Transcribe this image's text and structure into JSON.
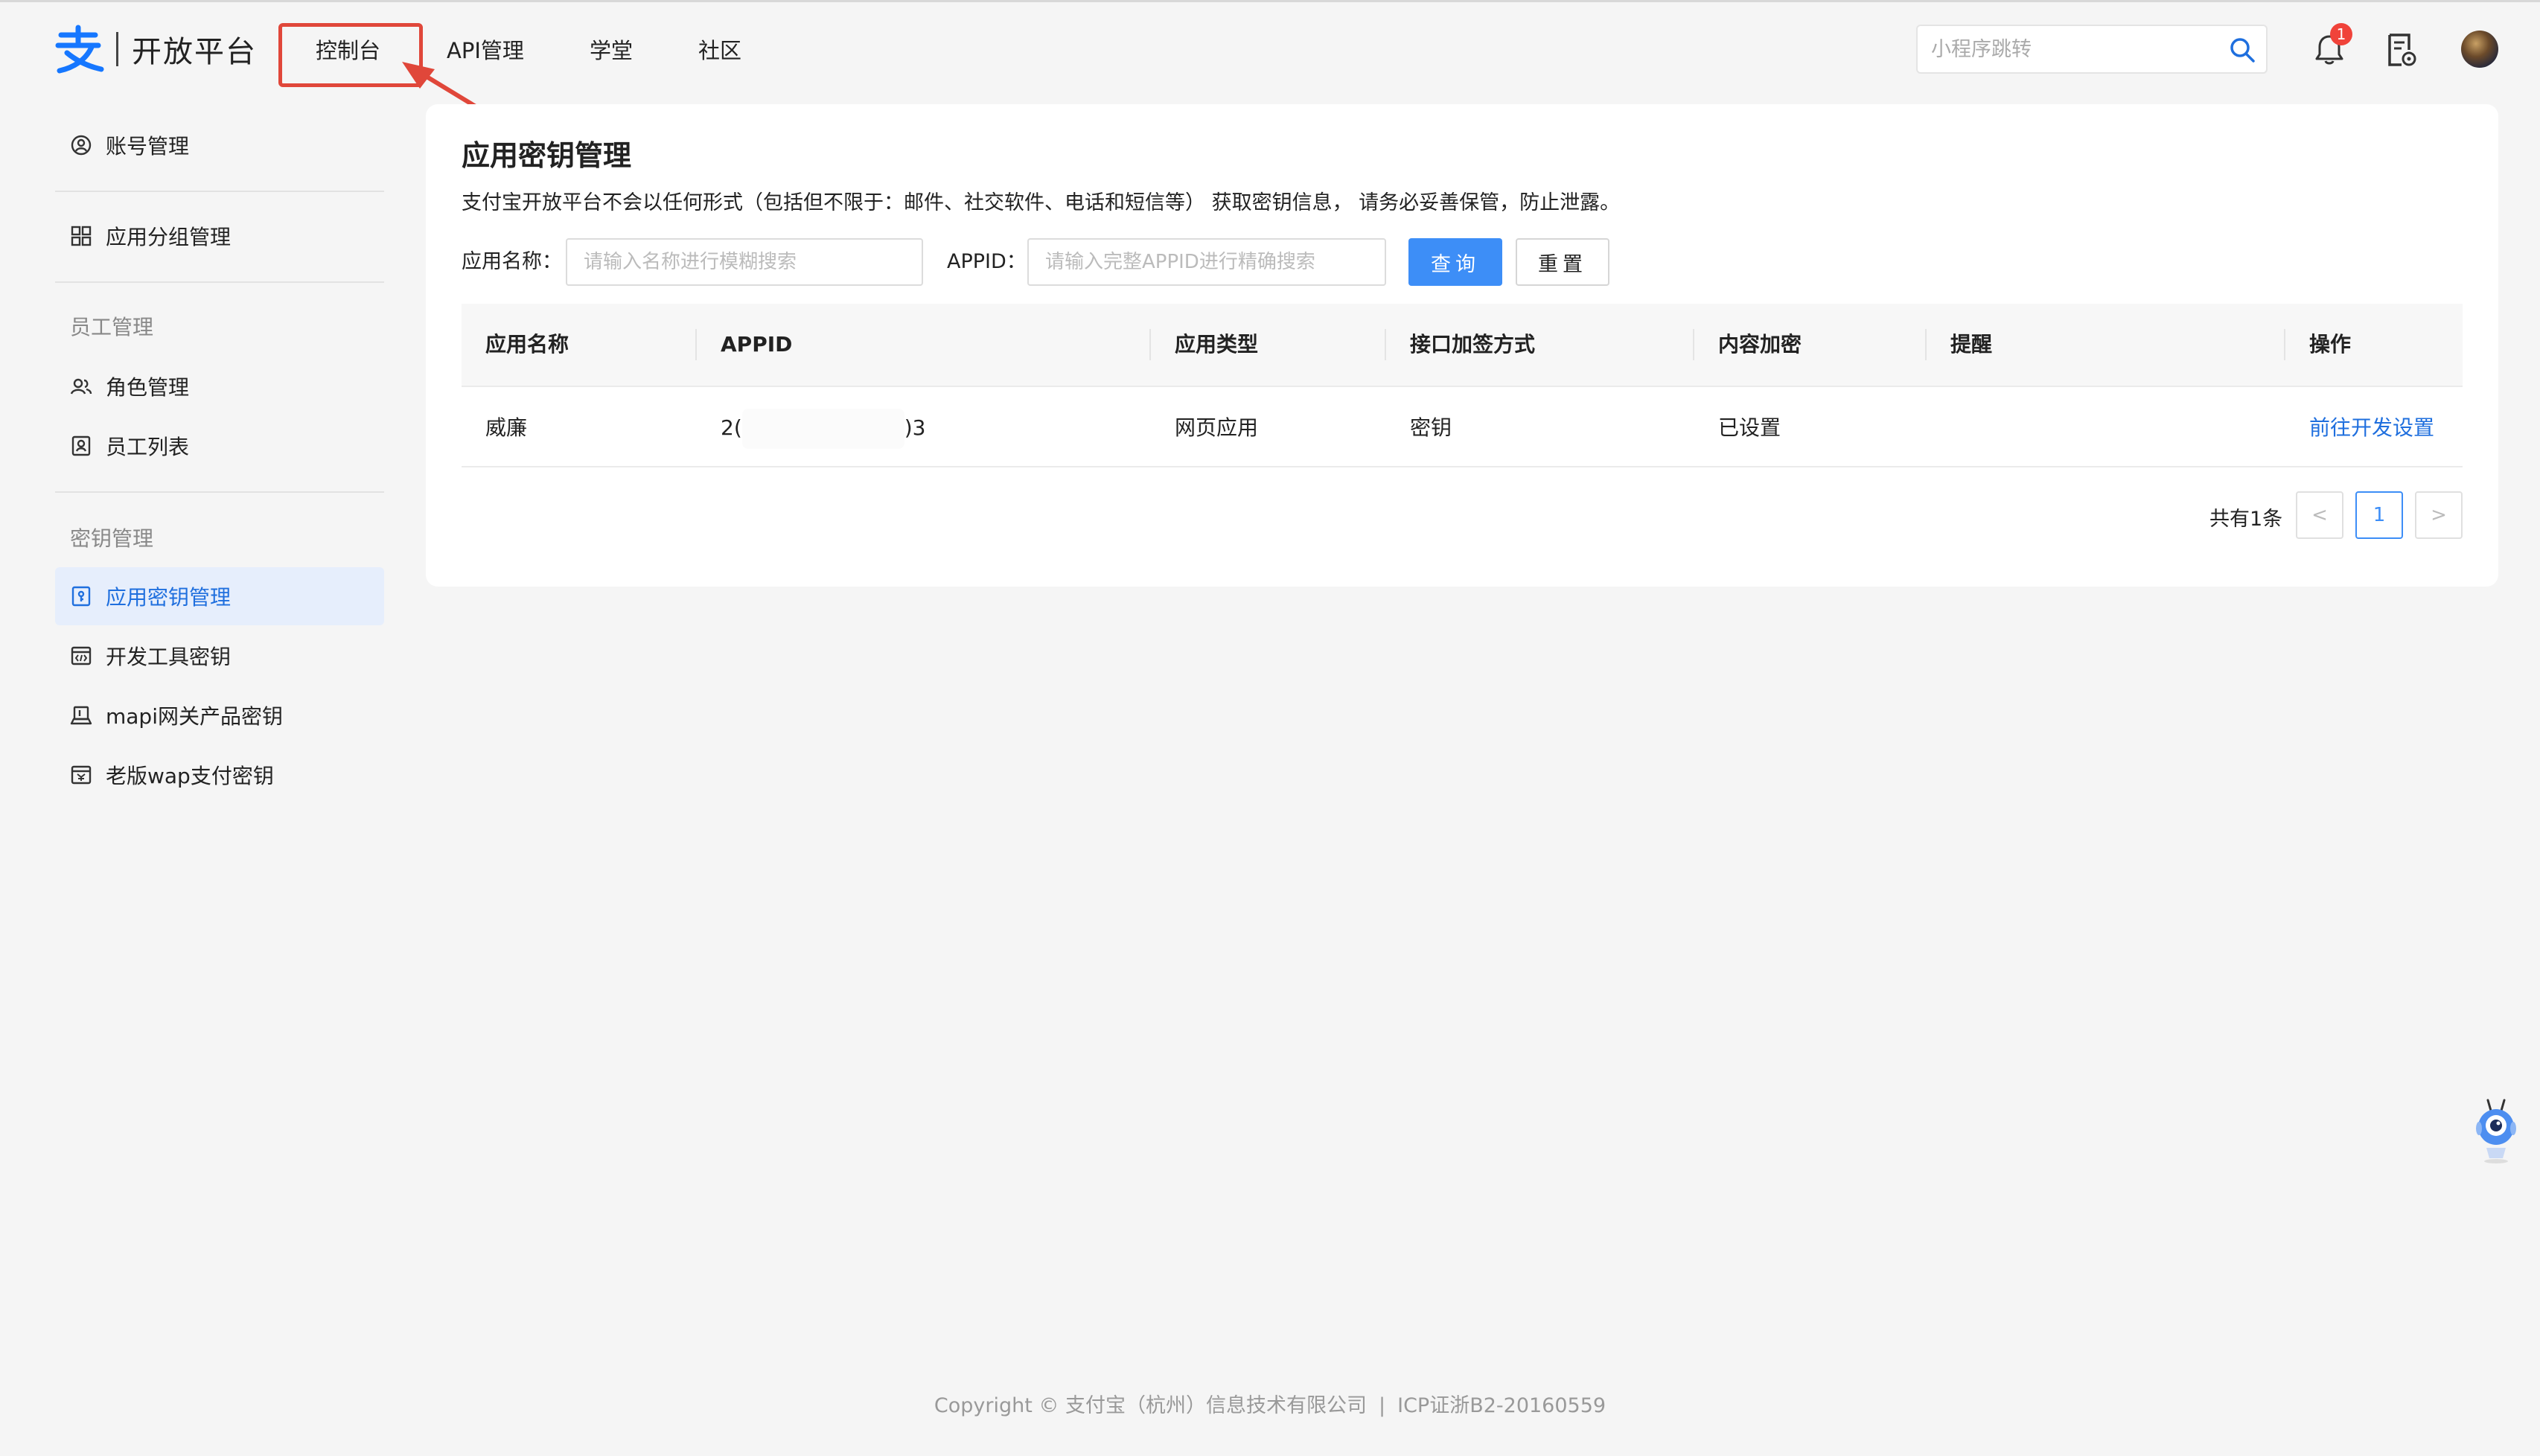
{
  "header": {
    "logo_text": "开放平台",
    "nav": [
      {
        "label": "控制台"
      },
      {
        "label": "API管理"
      },
      {
        "label": "学堂"
      },
      {
        "label": "社区"
      }
    ],
    "search_placeholder": "小程序跳转",
    "notification_count": "1",
    "accent_color": "#1677ff",
    "annotation_color": "#e0473a"
  },
  "sidebar": {
    "items": [
      {
        "label": "账号管理",
        "icon": "user-circle-icon"
      },
      {
        "label": "应用分组管理",
        "icon": "grid-icon"
      }
    ],
    "groups": [
      {
        "title": "员工管理",
        "items": [
          {
            "label": "角色管理",
            "icon": "users-icon"
          },
          {
            "label": "员工列表",
            "icon": "contact-card-icon"
          }
        ]
      },
      {
        "title": "密钥管理",
        "items": [
          {
            "label": "应用密钥管理",
            "icon": "key-doc-icon",
            "active": true
          },
          {
            "label": "开发工具密钥",
            "icon": "code-window-icon"
          },
          {
            "label": "mapi网关产品密钥",
            "icon": "laptop-icon"
          },
          {
            "label": "老版wap支付密钥",
            "icon": "payment-window-icon"
          }
        ]
      }
    ]
  },
  "main": {
    "title": "应用密钥管理",
    "notice": "支付宝开放平台不会以任何形式（包括但不限于：邮件、社交软件、电话和短信等） 获取密钥信息， 请务必妥善保管，防止泄露。",
    "filters": {
      "name_label": "应用名称：",
      "name_placeholder": "请输入名称进行模糊搜索",
      "appid_label": "APPID：",
      "appid_placeholder": "请输入完整APPID进行精确搜索",
      "query_label": "查询",
      "reset_label": "重置"
    },
    "table": {
      "columns": [
        "应用名称",
        "APPID",
        "应用类型",
        "接口加签方式",
        "内容加密",
        "提醒",
        "操作"
      ],
      "rows": [
        {
          "name": "威廉",
          "appid_prefix": "2(",
          "appid_suffix": ")3",
          "type": "网页应用",
          "sign_method": "密钥",
          "encryption": "已设置",
          "reminder": "",
          "action": "前往开发设置"
        }
      ]
    },
    "pagination": {
      "total_text": "共有1条",
      "prev": "<",
      "current_page": "1",
      "next": ">"
    }
  },
  "footer": {
    "copyright": "Copyright © 支付宝（杭州）信息技术有限公司",
    "separator": "|",
    "icp": "ICP证浙B2-20160559"
  }
}
